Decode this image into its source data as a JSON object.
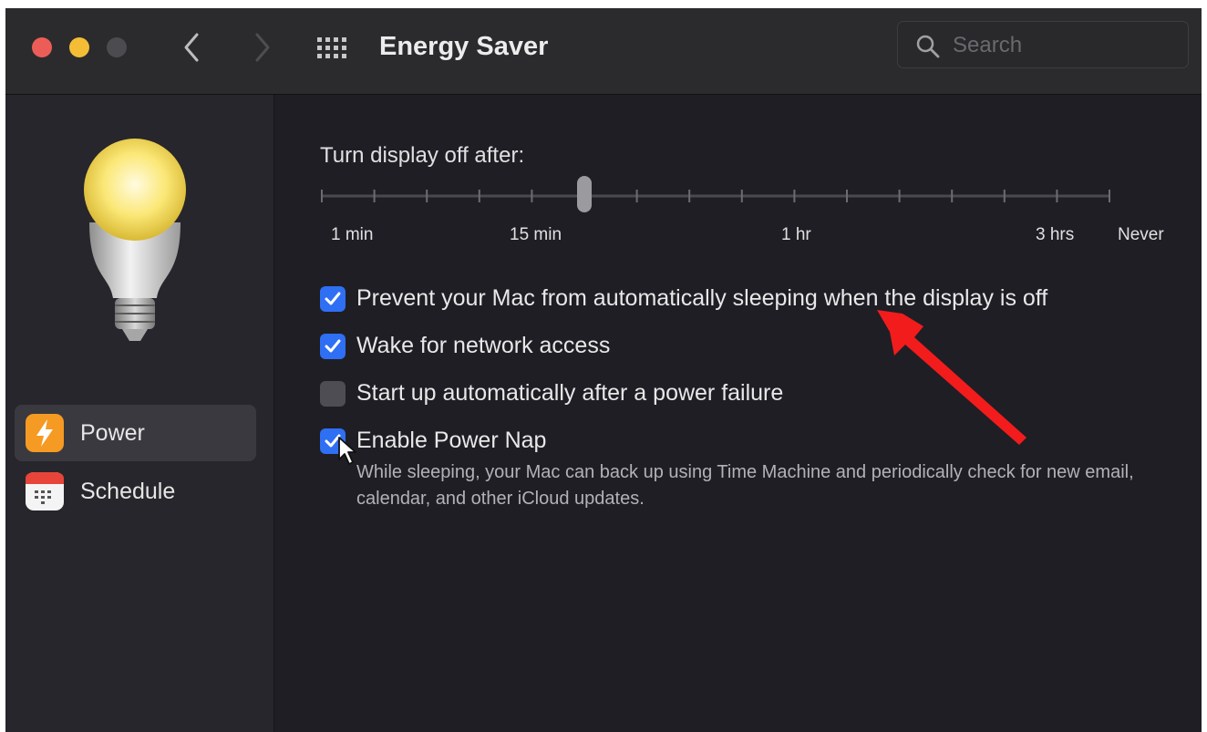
{
  "window": {
    "title": "Energy Saver",
    "search": {
      "placeholder": "Search"
    },
    "traffic_lights": {
      "close": "#ed5d57",
      "minimize": "#f5bd36",
      "zoom": "#4c4c50"
    }
  },
  "sidebar": {
    "items": [
      {
        "label": "Power",
        "icon": "power-bolt-icon",
        "selected": true
      },
      {
        "label": "Schedule",
        "icon": "calendar-icon",
        "selected": false
      }
    ]
  },
  "display_sleep": {
    "label": "Turn display off after:",
    "tick_labels": [
      "1 min",
      "15 min",
      "1 hr",
      "3 hrs",
      "Never"
    ],
    "tick_count": 16,
    "thumb_index": 5
  },
  "options": [
    {
      "label": "Prevent your Mac from automatically sleeping when the display is off",
      "checked": true
    },
    {
      "label": "Wake for network access",
      "checked": true
    },
    {
      "label": "Start up automatically after a power failure",
      "checked": false
    },
    {
      "label": "Enable Power Nap",
      "checked": true
    }
  ],
  "power_nap_note": "While sleeping, your Mac can back up using Time Machine and periodically check for new email, calendar, and other iCloud updates.",
  "colors": {
    "accent": "#2e6ff3",
    "annotation_arrow": "#f21c1c",
    "power_icon": "#f59a23"
  }
}
